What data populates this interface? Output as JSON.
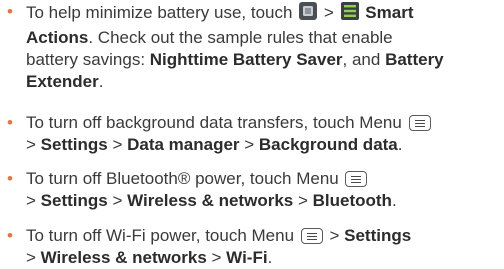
{
  "colors": {
    "bullet": "#e8743b",
    "text": "#3a3a3a"
  },
  "bullet_glyph": "•",
  "tips": [
    {
      "lines": [
        [
          "To help minimize battery use, touch ",
          {
            "icon": "app-square-icon"
          },
          " > ",
          {
            "icon": "smart-actions-icon"
          },
          " ",
          {
            "b": "Smart"
          }
        ],
        [
          {
            "b": "Actions"
          },
          ". Check out the sample rules that enable"
        ],
        [
          "battery savings: ",
          {
            "b": "Nighttime Battery Saver"
          },
          ", and ",
          {
            "b": "Battery"
          }
        ],
        [
          {
            "b": "Extender"
          },
          "."
        ]
      ]
    },
    {
      "lines": [
        [
          "To turn off background data transfers, touch Menu ",
          {
            "icon": "menu-icon"
          }
        ],
        [
          "> ",
          {
            "b": "Settings"
          },
          " > ",
          {
            "b": "Data manager"
          },
          " > ",
          {
            "b": "Background data"
          },
          "."
        ]
      ]
    },
    {
      "lines": [
        [
          "To turn off Bluetooth® power, touch Menu ",
          {
            "icon": "menu-icon"
          }
        ],
        [
          "> ",
          {
            "b": "Settings"
          },
          " > ",
          {
            "b": "Wireless & networks"
          },
          " > ",
          {
            "b": "Bluetooth"
          },
          "."
        ]
      ]
    },
    {
      "lines": [
        [
          "To turn off Wi-Fi power, touch Menu ",
          {
            "icon": "menu-icon"
          },
          " > ",
          {
            "b": "Settings"
          }
        ],
        [
          "> ",
          {
            "b": "Wireless & networks"
          },
          " > ",
          {
            "b": "Wi-Fi"
          },
          "."
        ]
      ]
    }
  ]
}
